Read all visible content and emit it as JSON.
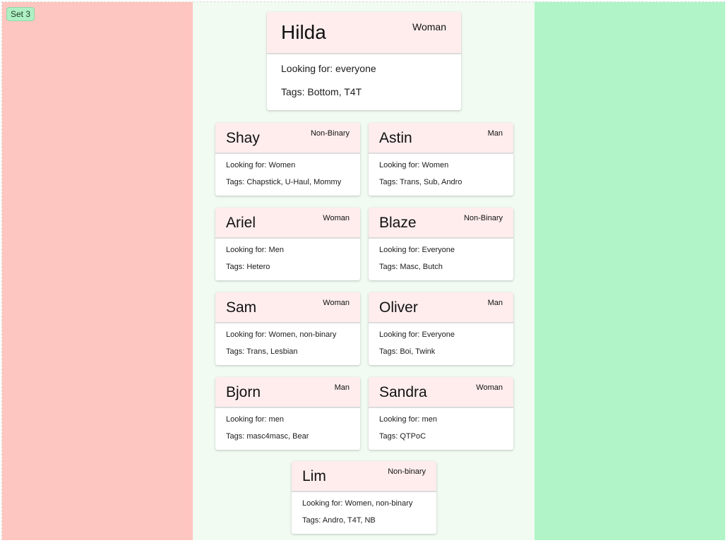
{
  "set_label": "Set 3",
  "colors": {
    "reject_panel": "#fec6c0",
    "center_panel": "#f1fbf2",
    "accept_panel": "#b0f4c7",
    "card_header": "#ffeded"
  },
  "featured": {
    "name": "Hilda",
    "gender": "Woman",
    "looking_for": "Looking for: everyone",
    "tags": "Tags: Bottom, T4T"
  },
  "cards": [
    {
      "name": "Shay",
      "gender": "Non-Binary",
      "looking_for": "Looking for: Women",
      "tags": "Tags: Chapstick, U-Haul, Mommy"
    },
    {
      "name": "Astin",
      "gender": "Man",
      "looking_for": "Looking for: Women",
      "tags": "Tags: Trans, Sub, Andro"
    },
    {
      "name": "Ariel",
      "gender": "Woman",
      "looking_for": "Looking for: Men",
      "tags": "Tags: Hetero"
    },
    {
      "name": "Blaze",
      "gender": "Non-Binary",
      "looking_for": "Looking for: Everyone",
      "tags": "Tags: Masc, Butch"
    },
    {
      "name": "Sam",
      "gender": "Woman",
      "looking_for": "Looking for: Women, non-binary",
      "tags": "Tags: Trans, Lesbian"
    },
    {
      "name": "Oliver",
      "gender": "Man",
      "looking_for": "Looking for: Everyone",
      "tags": "Tags: Boi, Twink"
    },
    {
      "name": "Bjorn",
      "gender": "Man",
      "looking_for": "Looking for: men",
      "tags": "Tags: masc4masc, Bear"
    },
    {
      "name": "Sandra",
      "gender": "Woman",
      "looking_for": "Looking for: men",
      "tags": "Tags: QTPoC"
    },
    {
      "name": "Lim",
      "gender": "Non-binary",
      "looking_for": "Looking for: Women, non-binary",
      "tags": "Tags: Andro, T4T, NB"
    }
  ]
}
